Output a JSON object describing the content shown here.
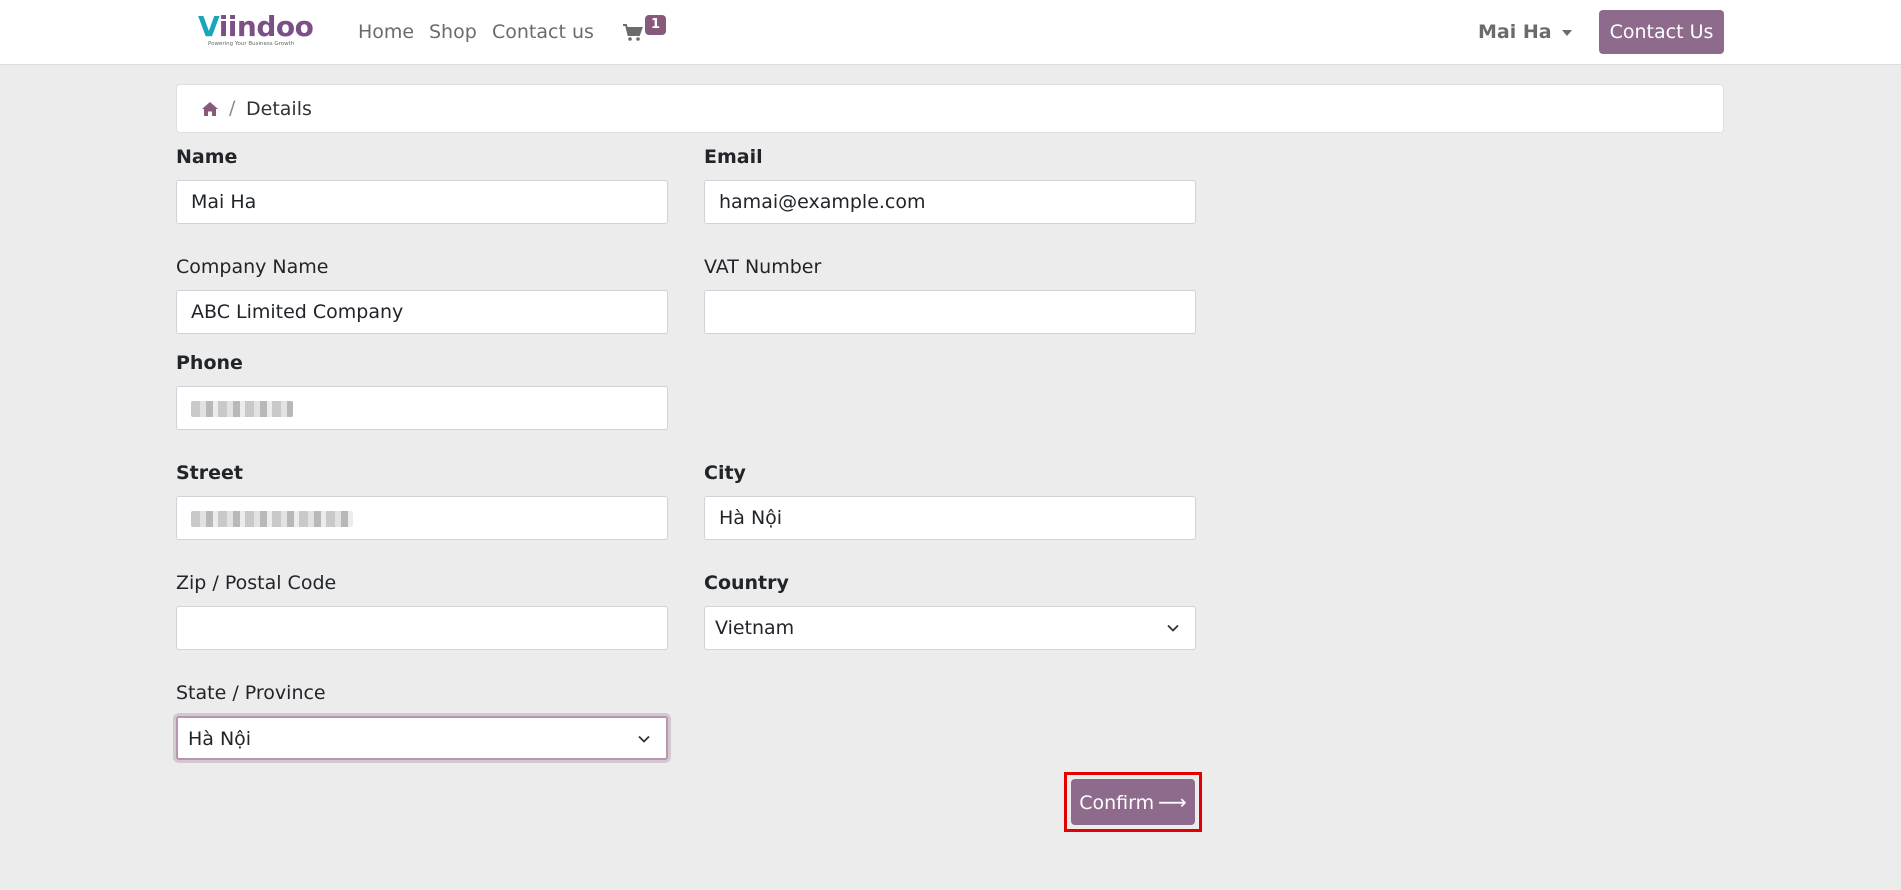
{
  "header": {
    "logo": {
      "v": "V",
      "rest": "iindoo",
      "tagline": "Powering Your Business Growth"
    },
    "nav": [
      {
        "label": "Home"
      },
      {
        "label": "Shop"
      },
      {
        "label": "Contact us"
      }
    ],
    "cart_count": "1",
    "user_name": "Mai Ha",
    "contact_button": "Contact Us"
  },
  "breadcrumb": {
    "home_icon": "home-icon",
    "separator": "/",
    "current": "Details"
  },
  "form": {
    "name": {
      "label": "Name",
      "value": "Mai Ha"
    },
    "email": {
      "label": "Email",
      "value": "hamai@example.com"
    },
    "company": {
      "label": "Company Name",
      "value": "ABC Limited Company"
    },
    "vat": {
      "label": "VAT Number",
      "value": ""
    },
    "phone": {
      "label": "Phone",
      "value": ""
    },
    "street": {
      "label": "Street",
      "value": ""
    },
    "city": {
      "label": "City",
      "value": "Hà Nội"
    },
    "zip": {
      "label": "Zip / Postal Code",
      "value": ""
    },
    "country": {
      "label": "Country",
      "value": "Vietnam"
    },
    "state": {
      "label": "State / Province",
      "value": "Hà Nội"
    },
    "confirm_label": "Confirm"
  },
  "colors": {
    "accent": "#875a7b",
    "button": "#8e6a8c",
    "highlight": "#e30000"
  }
}
